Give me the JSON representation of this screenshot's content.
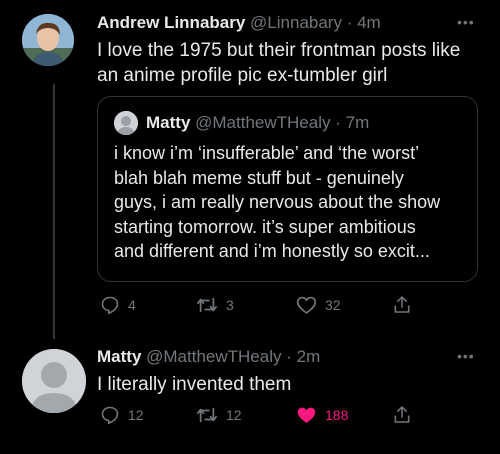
{
  "tweets": [
    {
      "author_name": "Andrew Linnabary",
      "handle": "@Linnabary",
      "time": "· 4m",
      "text_line1": "I love the 1975 but their frontman posts like",
      "text_line2": "an anime profile pic ex-tumbler girl",
      "quote": {
        "author_name": "Matty",
        "handle": "@MatthewTHealy",
        "time": "· 7m",
        "lines": [
          "i know i’m ‘insufferable’ and ‘the worst’",
          "blah blah meme stuff but - genuinely",
          "guys, i am really nervous about the show",
          "starting tomorrow. it’s super ambitious",
          "and different and i’m honestly so excit..."
        ]
      },
      "actions": {
        "replies": "4",
        "retweets": "3",
        "likes": "32"
      }
    },
    {
      "author_name": "Matty",
      "handle": "@MatthewTHealy",
      "time": "· 2m",
      "text_line1": "I literally invented them",
      "actions": {
        "replies": "12",
        "retweets": "12",
        "likes": "188"
      }
    }
  ],
  "colors": {
    "background": "#000000",
    "text": "#e7e9ea",
    "muted": "#71767b",
    "like_active": "#f91880"
  }
}
